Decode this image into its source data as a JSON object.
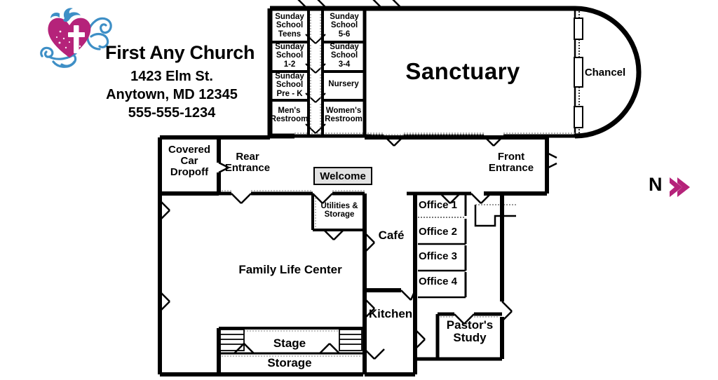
{
  "header": {
    "church_name": "First Any Church",
    "address_line1": "1423 Elm St.",
    "address_line2": "Anytown, MD 12345",
    "phone": "555-555-1234",
    "logo": {
      "name": "heart-cross-dove-logo",
      "heart_color": "#B5237A",
      "accent_color": "#3E8FC6",
      "cross_color": "#FFFFFF"
    }
  },
  "compass": {
    "letter": "N",
    "arrow_color": "#B5237A",
    "direction": "right"
  },
  "plan": {
    "title": "Church Floor Plan",
    "wall_color": "#000000",
    "fill_color": "#FFFFFF",
    "desk_fill": "#E2E2E2",
    "rooms": [
      {
        "id": "sunday-school-teens",
        "label": "Sunday\nSchool\nTeens",
        "label_lines": [
          "Sunday",
          "School",
          "Teens"
        ]
      },
      {
        "id": "sunday-school-1-2",
        "label": "Sunday\nSchool\n1-2",
        "label_lines": [
          "Sunday",
          "School",
          "1-2"
        ]
      },
      {
        "id": "sunday-school-pre-k",
        "label": "Sunday\nSchool\nPre - K",
        "label_lines": [
          "Sunday",
          "School",
          "Pre - K"
        ]
      },
      {
        "id": "mens-restroom",
        "label": "Men's\nRestroom",
        "label_lines": [
          "Men's",
          "Restroom"
        ]
      },
      {
        "id": "sunday-school-5-6",
        "label": "Sunday\nSchool\n5-6",
        "label_lines": [
          "Sunday",
          "School",
          "5-6"
        ]
      },
      {
        "id": "sunday-school-3-4",
        "label": "Sunday\nSchool\n3-4",
        "label_lines": [
          "Sunday",
          "School",
          "3-4"
        ]
      },
      {
        "id": "nursery",
        "label": "Nursery",
        "label_lines": [
          "Nursery"
        ]
      },
      {
        "id": "womens-restroom",
        "label": "Women's\nRestroom",
        "label_lines": [
          "Women's",
          "Restroom"
        ]
      },
      {
        "id": "sanctuary",
        "label": "Sanctuary",
        "label_lines": [
          "Sanctuary"
        ]
      },
      {
        "id": "chancel",
        "label": "Chancel",
        "label_lines": [
          "Chancel"
        ]
      },
      {
        "id": "covered-car-dropoff",
        "label": "Covered\nCar\nDropoff",
        "label_lines": [
          "Covered",
          "Car",
          "Dropoff"
        ]
      },
      {
        "id": "rear-entrance",
        "label": "Rear\nEntrance",
        "label_lines": [
          "Rear",
          "Entrance"
        ]
      },
      {
        "id": "front-entrance",
        "label": "Front\nEntrance",
        "label_lines": [
          "Front",
          "Entrance"
        ]
      },
      {
        "id": "welcome-desk",
        "label": "Welcome",
        "label_lines": [
          "Welcome"
        ]
      },
      {
        "id": "utilities-storage",
        "label": "Utilities &\nStorage",
        "label_lines": [
          "Utilities &",
          "Storage"
        ]
      },
      {
        "id": "cafe",
        "label": "Café",
        "label_lines": [
          "Café"
        ]
      },
      {
        "id": "office-1",
        "label": "Office 1",
        "label_lines": [
          "Office 1"
        ]
      },
      {
        "id": "office-2",
        "label": "Office 2",
        "label_lines": [
          "Office 2"
        ]
      },
      {
        "id": "office-3",
        "label": "Office 3",
        "label_lines": [
          "Office 3"
        ]
      },
      {
        "id": "office-4",
        "label": "Office 4",
        "label_lines": [
          "Office 4"
        ]
      },
      {
        "id": "family-life-center",
        "label": "Family Life Center",
        "label_lines": [
          "Family Life Center"
        ]
      },
      {
        "id": "kitchen",
        "label": "Kitchen",
        "label_lines": [
          "Kitchen"
        ]
      },
      {
        "id": "pastors-study",
        "label": "Pastor's\nStudy",
        "label_lines": [
          "Pastor's",
          "Study"
        ]
      },
      {
        "id": "stage",
        "label": "Stage",
        "label_lines": [
          "Stage"
        ]
      },
      {
        "id": "storage",
        "label": "Storage",
        "label_lines": [
          "Storage"
        ]
      }
    ],
    "labels": {
      "ss_teens_1": "Sunday",
      "ss_teens_2": "School",
      "ss_teens_3": "Teens",
      "ss_12_1": "Sunday",
      "ss_12_2": "School",
      "ss_12_3": "1-2",
      "ss_prek_1": "Sunday",
      "ss_prek_2": "School",
      "ss_prek_3": "Pre - K",
      "mens_1": "Men's",
      "mens_2": "Restroom",
      "ss_56_1": "Sunday",
      "ss_56_2": "School",
      "ss_56_3": "5-6",
      "ss_34_1": "Sunday",
      "ss_34_2": "School",
      "ss_34_3": "3-4",
      "nursery": "Nursery",
      "womens_1": "Women's",
      "womens_2": "Restroom",
      "sanctuary": "Sanctuary",
      "chancel": "Chancel",
      "dropoff_1": "Covered",
      "dropoff_2": "Car",
      "dropoff_3": "Dropoff",
      "rear_1": "Rear",
      "rear_2": "Entrance",
      "front_1": "Front",
      "front_2": "Entrance",
      "welcome": "Welcome",
      "util_1": "Utilities &",
      "util_2": "Storage",
      "cafe": "Café",
      "office1": "Office 1",
      "office2": "Office 2",
      "office3": "Office 3",
      "office4": "Office 4",
      "flc": "Family Life Center",
      "kitchen": "Kitchen",
      "pastor_1": "Pastor's",
      "pastor_2": "Study",
      "stage": "Stage",
      "storage": "Storage"
    }
  }
}
